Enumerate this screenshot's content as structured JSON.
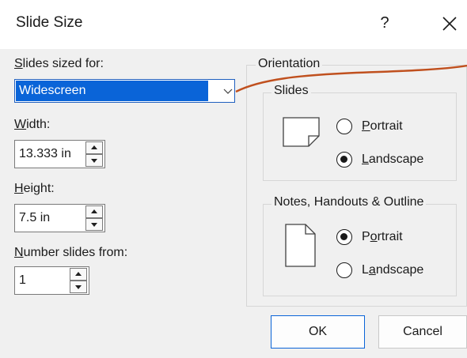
{
  "dialog": {
    "title": "Slide Size",
    "help_label": "?",
    "close_icon": "close-icon"
  },
  "size": {
    "label": "Slides sized for:",
    "selected": "Widescreen"
  },
  "width": {
    "label": "Width:",
    "value": "13.333 in"
  },
  "height": {
    "label": "Height:",
    "value": "7.5 in"
  },
  "number_from": {
    "label": "Number slides from:",
    "value": "1"
  },
  "orientation": {
    "label": "Orientation",
    "slides": {
      "label": "Slides",
      "portrait": "Portrait",
      "landscape": "Landscape",
      "selected": "Landscape"
    },
    "notes": {
      "label": "Notes, Handouts & Outline",
      "portrait": "Portrait",
      "landscape": "Landscape",
      "selected": "Portrait"
    }
  },
  "buttons": {
    "ok": "OK",
    "cancel": "Cancel"
  },
  "colors": {
    "selection": "#0a64d8",
    "annotation": "#c0501e"
  }
}
